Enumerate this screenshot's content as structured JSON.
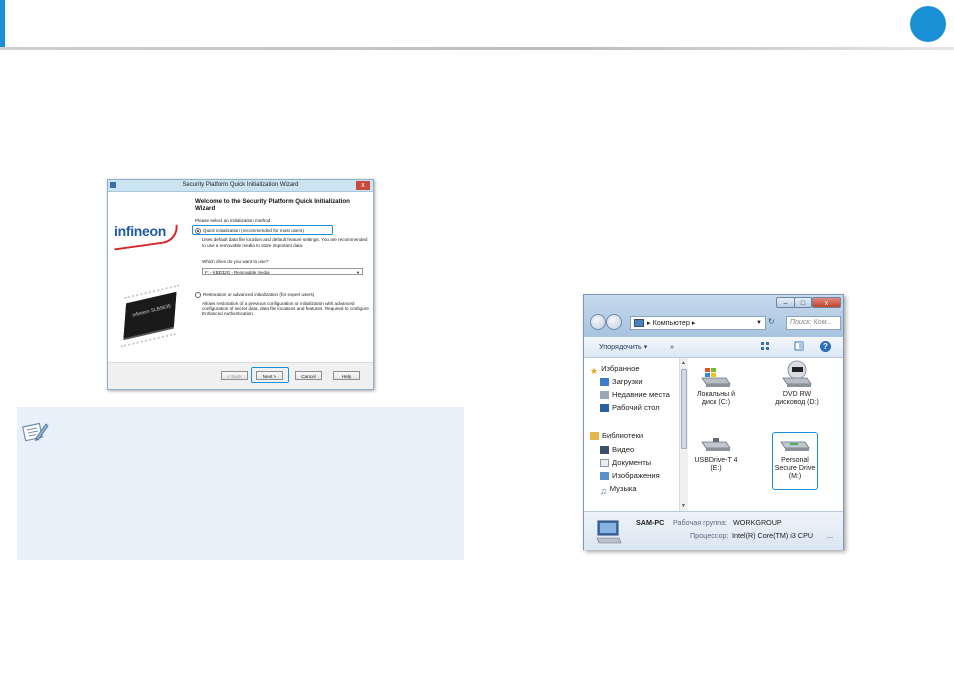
{
  "page": {
    "accent": "#1a8fd6"
  },
  "wizard": {
    "title": "Security Platform Quick Initialization Wizard",
    "close_glyph": "x",
    "logo_text": "infineon",
    "chip_text": "infineon SLB9635",
    "heading": "Welcome to the Security Platform Quick Initialization Wizard",
    "prompt": "Please select an initialization method:",
    "option_quick": "Quick initialization (recommended for most users)",
    "quick_desc": "Uses default data file location and default feature settings. You are recommended to use a removable media to store important data.",
    "drive_question": "Which drive do you want to use?",
    "drive_value": "F: - KBD32G - Removable media",
    "option_advanced": "Restoration or advanced initialization (for expert users)",
    "advanced_desc": "Allows restoration of a previous configuration or initialization with advanced configuration of secret data, data file locations and features. Required to configure Enhanced Authentication.",
    "buttons": {
      "back": "< Back",
      "next": "Next >",
      "cancel": "Cancel",
      "help": "Help"
    }
  },
  "explorer": {
    "window_buttons": {
      "min": "–",
      "max": "□",
      "close": "x"
    },
    "address": [
      "Компьютер",
      "▸"
    ],
    "address_arrow": "▸",
    "search_placeholder": "Поиск: Ком...",
    "toolbar": {
      "organize": "Упорядочить ▾",
      "more": "»"
    },
    "nav": {
      "favorites": "Избранное",
      "fav_items": [
        "Загрузки",
        "Недавние места",
        "Рабочий стол"
      ],
      "libraries": "Библиотеки",
      "lib_items": [
        "Видео",
        "Документы",
        "Изображения",
        "Музыка"
      ]
    },
    "drives": [
      {
        "name": "Локальны й диск (C:)",
        "icon": "hard-drive-windows"
      },
      {
        "name": "DVD RW дисковод (D:)",
        "icon": "dvd-drive"
      },
      {
        "name": "USBDrive-T 4 (E:)",
        "icon": "usb-drive"
      },
      {
        "name": "Personal Secure Drive (M:)",
        "icon": "secure-drive"
      }
    ],
    "details": {
      "computer": "SAM-PC",
      "workgroup_label": "Рабочая группа:",
      "workgroup": "WORKGROUP",
      "cpu_label": "Процессор:",
      "cpu": "Intel(R) Core(TM) i3 CPU",
      "ellipsis": "..."
    }
  }
}
